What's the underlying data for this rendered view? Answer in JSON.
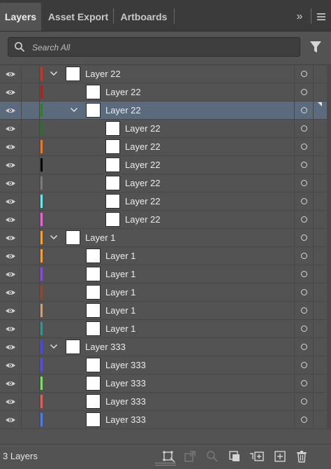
{
  "tabs": [
    {
      "label": "Layers",
      "active": true
    },
    {
      "label": "Asset Export",
      "active": false
    },
    {
      "label": "Artboards",
      "active": false
    }
  ],
  "header": {
    "overflow_glyph": "»",
    "menu_icon": "hamburger-menu-icon"
  },
  "search": {
    "placeholder": "Search All",
    "value": ""
  },
  "rows": [
    {
      "name": "Layer 22",
      "level": 0,
      "expanded": true,
      "color": "#c0392b",
      "selected": false
    },
    {
      "name": "Layer 22",
      "level": 1,
      "expanded": null,
      "color": "#a0281f",
      "selected": false
    },
    {
      "name": "Layer 22",
      "level": 1,
      "expanded": true,
      "color": "#2e7d32",
      "selected": true
    },
    {
      "name": "Layer 22",
      "level": 2,
      "expanded": null,
      "color": "#2e6b2e",
      "selected": false
    },
    {
      "name": "Layer 22",
      "level": 2,
      "expanded": null,
      "color": "#e07a2e",
      "selected": false
    },
    {
      "name": "Layer 22",
      "level": 2,
      "expanded": null,
      "color": "#000000",
      "selected": false
    },
    {
      "name": "Layer 22",
      "level": 2,
      "expanded": null,
      "color": "#7a7a7a",
      "selected": false
    },
    {
      "name": "Layer 22",
      "level": 2,
      "expanded": null,
      "color": "#6ee6f0",
      "selected": false
    },
    {
      "name": "Layer 22",
      "level": 2,
      "expanded": null,
      "color": "#e36ad6",
      "selected": false
    },
    {
      "name": "Layer 1",
      "level": 0,
      "expanded": true,
      "color": "#f0a040",
      "selected": false
    },
    {
      "name": "Layer 1",
      "level": 1,
      "expanded": null,
      "color": "#f0a040",
      "selected": false
    },
    {
      "name": "Layer 1",
      "level": 1,
      "expanded": null,
      "color": "#8a4fd8",
      "selected": false
    },
    {
      "name": "Layer 1",
      "level": 1,
      "expanded": null,
      "color": "#8b4a2b",
      "selected": false
    },
    {
      "name": "Layer 1",
      "level": 1,
      "expanded": null,
      "color": "#c8a27a",
      "selected": false
    },
    {
      "name": "Layer 1",
      "level": 1,
      "expanded": null,
      "color": "#3f8f8f",
      "selected": false
    },
    {
      "name": "Layer 333",
      "level": 0,
      "expanded": true,
      "color": "#4a4ae0",
      "selected": false
    },
    {
      "name": "Layer 333",
      "level": 1,
      "expanded": null,
      "color": "#5a4fd8",
      "selected": false
    },
    {
      "name": "Layer 333",
      "level": 1,
      "expanded": null,
      "color": "#7ee06a",
      "selected": false
    },
    {
      "name": "Layer 333",
      "level": 1,
      "expanded": null,
      "color": "#e0605a",
      "selected": false
    },
    {
      "name": "Layer 333",
      "level": 1,
      "expanded": null,
      "color": "#4f7ae0",
      "selected": false
    }
  ],
  "footer": {
    "count_label": "3 Layers",
    "icons": [
      "collect-for-export-icon",
      "locate-object-icon",
      "search-object-icon",
      "make-clipping-mask-icon",
      "create-sublayer-icon",
      "create-new-layer-icon",
      "delete-icon"
    ]
  },
  "colors": {
    "panel_bg": "#535353",
    "tabbar_bg": "#3b3b3b",
    "selected_row": "#5c6a7e"
  }
}
